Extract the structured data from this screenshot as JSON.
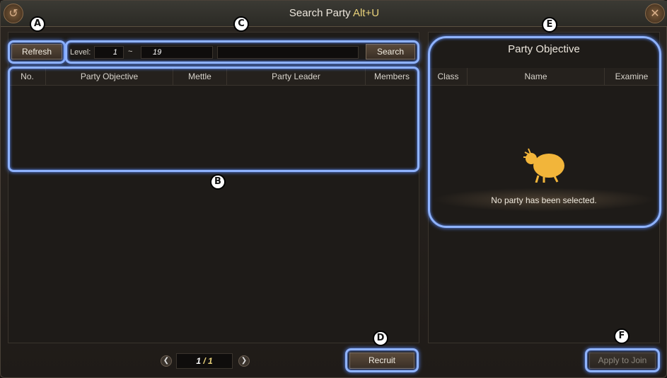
{
  "window": {
    "title": "Search Party",
    "hotkey": "Alt+U"
  },
  "toolbar": {
    "refresh_label": "Refresh",
    "level_label": "Level:",
    "level_min": "1",
    "level_sep": "~",
    "level_max": "19",
    "search_value": "",
    "search_label": "Search"
  },
  "party_table": {
    "headers": [
      "No.",
      "Party Objective",
      "Mettle",
      "Party Leader",
      "Members"
    ]
  },
  "pager": {
    "current": "1",
    "total": "/ 1"
  },
  "recruit_label": "Recruit",
  "details": {
    "title": "Party Objective",
    "headers": [
      "Class",
      "Name",
      "Examine"
    ],
    "empty_message": "No party has been selected."
  },
  "apply_label": "Apply to Join",
  "callouts": [
    "A",
    "B",
    "C",
    "D",
    "E",
    "F"
  ],
  "colors": {
    "highlight": "#8fb3ff",
    "hotkey": "#e9d27a",
    "page_number": "#e9d27a"
  }
}
